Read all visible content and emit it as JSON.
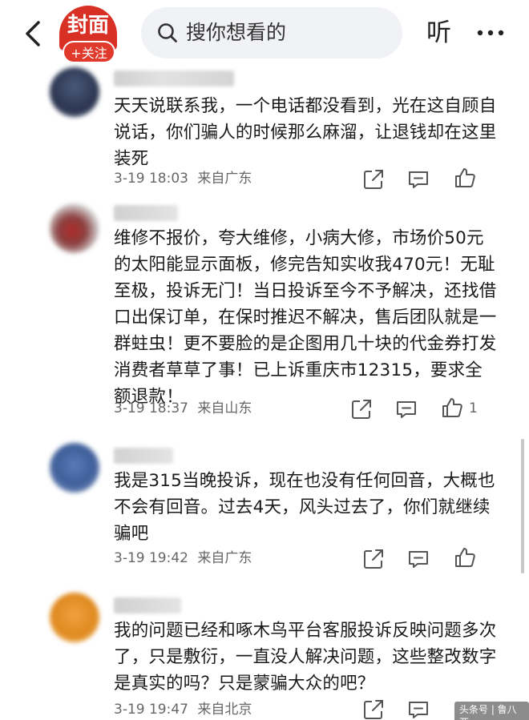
{
  "header": {
    "brand_logo_text": "封面",
    "follow_label": "+关注",
    "search_placeholder": "搜你想看的",
    "listen_label": "听"
  },
  "comments": [
    {
      "text": "天天说联系我，一个电话都没看到，光在这自顾自说话，你们骗人的时候那么麻溜，让退钱却在这里装死",
      "date": "3-19 18:03",
      "location": "来自广东",
      "likes": ""
    },
    {
      "text": "维修不报价，夸大维修，小病大修，市场价50元的太阳能显示面板，修完告知实收我470元！无耻至极，投诉无门！当日投诉至今不予解决，还找借口出保订单，在保时推迟不解决，售后团队就是一群蛀虫！更不要脸的是企图用几十块的代金券打发消费者草草了事！已上诉重庆市12315，要求全额退款！",
      "date": "3-19 18:37",
      "location": "来自山东",
      "likes": "1"
    },
    {
      "text": "我是315当晚投诉，现在也没有任何回音，大概也不会有回音。过去4天，风头过去了，你们就继续骗吧",
      "date": "3-19 19:42",
      "location": "来自广东",
      "likes": ""
    },
    {
      "text": "我的问题已经和啄木鸟平台客服投诉反映问题多次了，只是敷衍，一直没人解决问题，这些整改数字是真实的吗？只是蒙骗大众的吧？",
      "date": "3-19 19:47",
      "location": "来自北京",
      "likes": ""
    }
  ],
  "watermark": "头条号 | 鲁八两",
  "colors": {
    "brand_red": "#d93025",
    "search_bg": "#f1f2f5",
    "meta_gray": "#666666"
  }
}
